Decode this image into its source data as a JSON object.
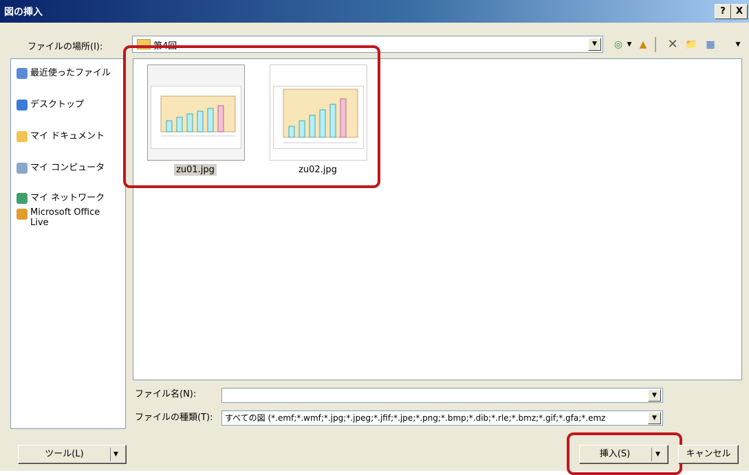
{
  "window": {
    "title": "図の挿入",
    "help_btn": "?",
    "close_btn": "X"
  },
  "location": {
    "label": "ファイルの場所(I):",
    "value": "第4回"
  },
  "toolbar": {
    "back": "◎",
    "up": "▲",
    "delete": "✕",
    "new_folder": "📁",
    "views": "▦"
  },
  "places": [
    {
      "label": "最近使ったファイル",
      "icon": "recent-icon"
    },
    {
      "label": "デスクトップ",
      "icon": "desktop-icon"
    },
    {
      "label": "マイ ドキュメント",
      "icon": "documents-icon"
    },
    {
      "label": "マイ コンピュータ",
      "icon": "computer-icon"
    },
    {
      "label": "マイ ネットワーク",
      "icon": "network-icon"
    },
    {
      "label": "Microsoft Office Live",
      "icon": "office-live-icon"
    }
  ],
  "files": [
    {
      "name": "zu01.jpg",
      "selected": true
    },
    {
      "name": "zu02.jpg",
      "selected": false
    }
  ],
  "filename": {
    "label": "ファイル名(N):",
    "value": ""
  },
  "filetype": {
    "label": "ファイルの種類(T):",
    "value": "すべての図 (*.emf;*.wmf;*.jpg;*.jpeg;*.jfif;*.jpe;*.png;*.bmp;*.dib;*.rle;*.bmz;*.gif;*.gfa;*.emz"
  },
  "buttons": {
    "tools": "ツール(L)",
    "insert": "挿入(S)",
    "cancel": "キャンセル"
  },
  "colors": {
    "highlight": "#c0161d",
    "bar_cyan": "#b7eef7",
    "bar_pink": "#f4c1d7",
    "chart_bg": "#f8e5b8"
  }
}
